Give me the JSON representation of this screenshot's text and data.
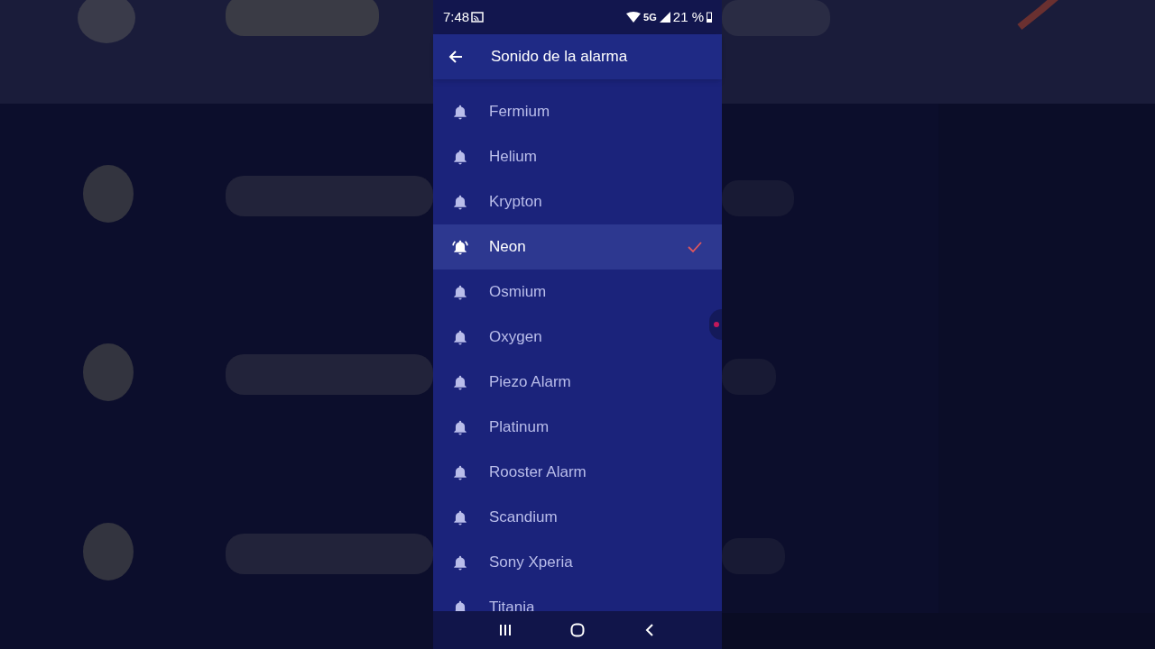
{
  "status_bar": {
    "time": "7:48",
    "network": "5G",
    "battery": "21 %"
  },
  "app_bar": {
    "title": "Sonido de la alarma"
  },
  "sounds": [
    {
      "label": "Fermium",
      "selected": false
    },
    {
      "label": "Helium",
      "selected": false
    },
    {
      "label": "Krypton",
      "selected": false
    },
    {
      "label": "Neon",
      "selected": true
    },
    {
      "label": "Osmium",
      "selected": false
    },
    {
      "label": "Oxygen",
      "selected": false
    },
    {
      "label": "Piezo Alarm",
      "selected": false
    },
    {
      "label": "Platinum",
      "selected": false
    },
    {
      "label": "Rooster Alarm",
      "selected": false
    },
    {
      "label": "Scandium",
      "selected": false
    },
    {
      "label": "Sony Xperia",
      "selected": false
    },
    {
      "label": "Titania",
      "selected": false
    }
  ]
}
